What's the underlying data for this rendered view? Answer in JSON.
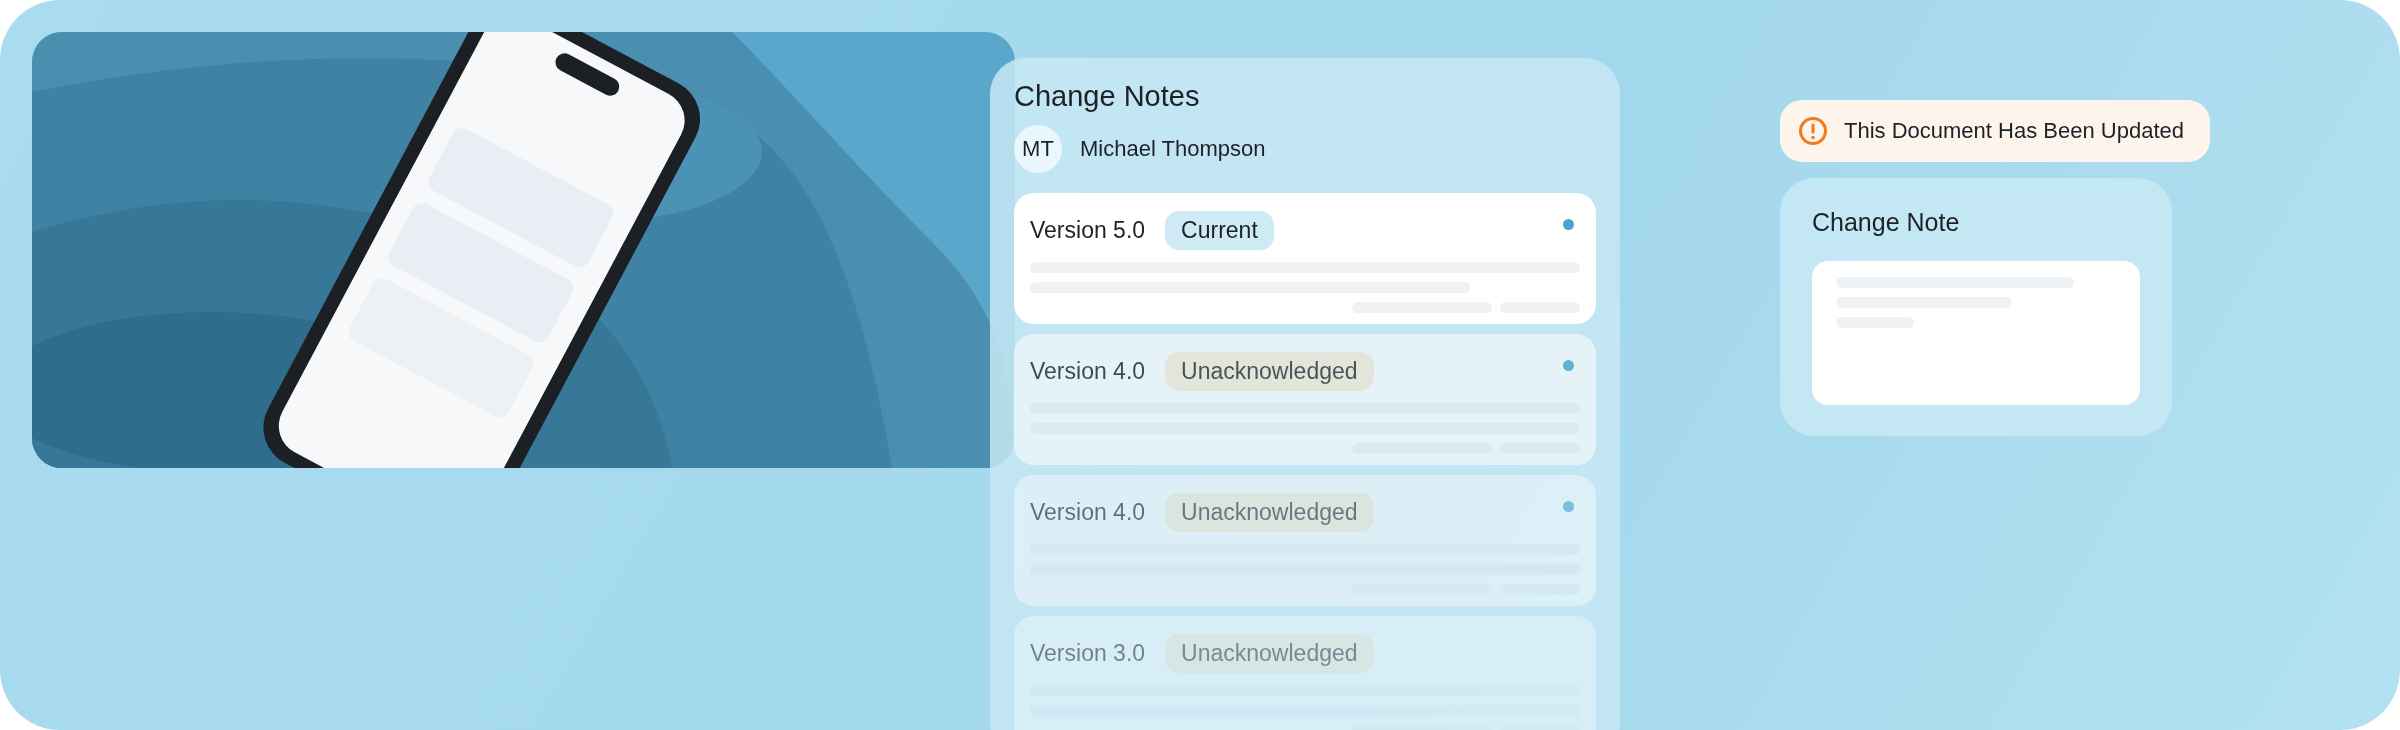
{
  "change_notes": {
    "title": "Change Notes",
    "user": {
      "initials": "MT",
      "name": "Michael Thompson"
    },
    "versions": [
      {
        "label": "Version 5.0",
        "badge": "Current",
        "kind": "current",
        "unread": true
      },
      {
        "label": "Version 4.0",
        "badge": "Unacknowledged",
        "kind": "unacknowledged",
        "unread": true
      },
      {
        "label": "Version 4.0",
        "badge": "Unacknowledged",
        "kind": "unacknowledged",
        "unread": true
      },
      {
        "label": "Version 3.0",
        "badge": "Unacknowledged",
        "kind": "unacknowledged",
        "unread": false
      }
    ]
  },
  "alert": {
    "text": "This Document Has Been Updated"
  },
  "change_note": {
    "title": "Change Note"
  }
}
